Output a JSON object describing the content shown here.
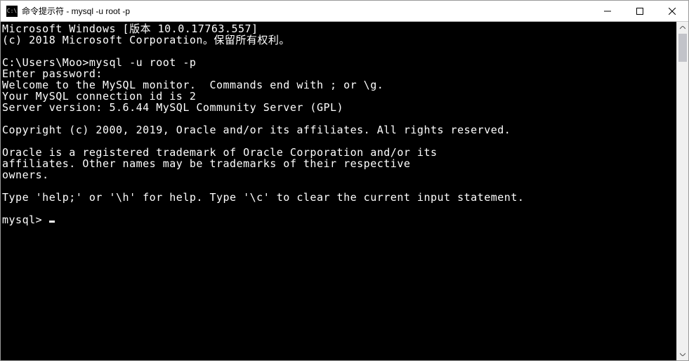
{
  "titlebar": {
    "icon_text": "C:\\",
    "title": "命令提示符 - mysql  -u root -p"
  },
  "console": {
    "lines": [
      "Microsoft Windows [版本 10.0.17763.557]",
      "(c) 2018 Microsoft Corporation。保留所有权利。",
      "",
      "C:\\Users\\Moo>mysql -u root -p",
      "Enter password:",
      "Welcome to the MySQL monitor.  Commands end with ; or \\g.",
      "Your MySQL connection id is 2",
      "Server version: 5.6.44 MySQL Community Server (GPL)",
      "",
      "Copyright (c) 2000, 2019, Oracle and/or its affiliates. All rights reserved.",
      "",
      "Oracle is a registered trademark of Oracle Corporation and/or its",
      "affiliates. Other names may be trademarks of their respective",
      "owners.",
      "",
      "Type 'help;' or '\\h' for help. Type '\\c' to clear the current input statement.",
      ""
    ],
    "prompt": "mysql> "
  }
}
